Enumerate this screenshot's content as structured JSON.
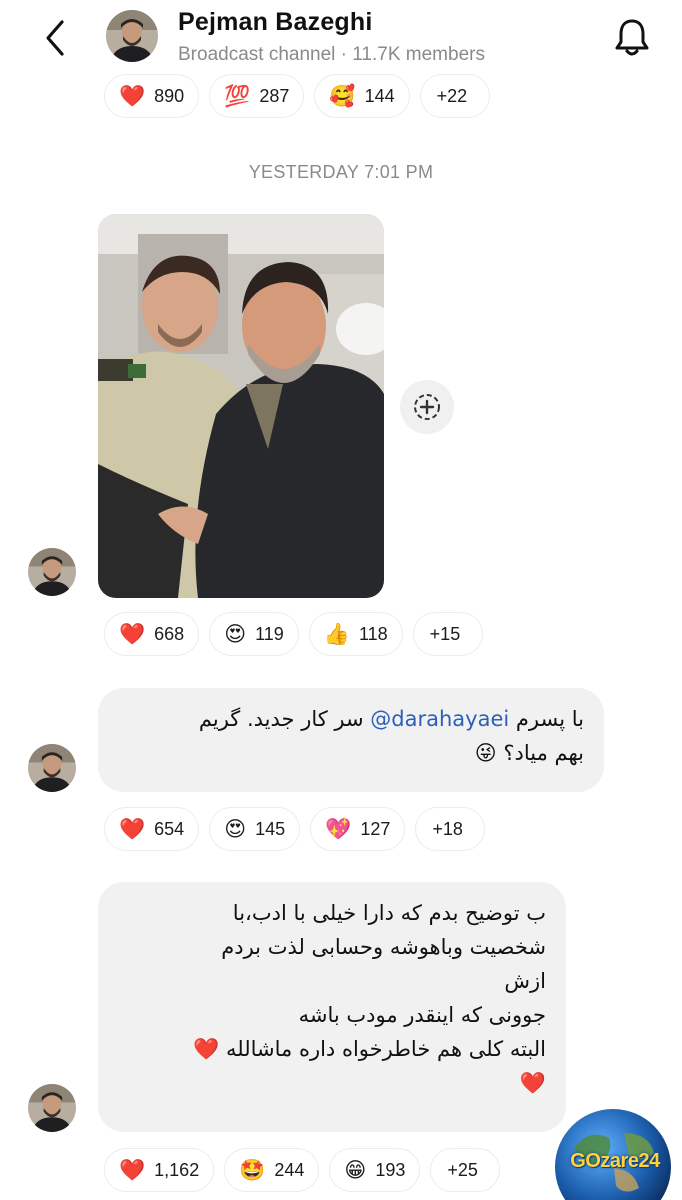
{
  "header": {
    "title": "Pejman Bazeghi",
    "subtitle": "Broadcast channel · 11.7K members",
    "back_icon": "chevron-left-icon",
    "bell_icon": "bell-icon"
  },
  "top_reactions": [
    {
      "emoji": "❤️",
      "count": "890"
    },
    {
      "emoji": "💯",
      "count": "287"
    },
    {
      "emoji": "🥰",
      "count": "144"
    },
    {
      "more": "+22"
    }
  ],
  "day_separator": "YESTERDAY 7:01 PM",
  "photo_reactions": [
    {
      "emoji": "❤️",
      "count": "668"
    },
    {
      "emoji": "😍",
      "count": "119"
    },
    {
      "emoji": "👍",
      "count": "118"
    },
    {
      "more": "+15"
    }
  ],
  "message1": {
    "line1_prefix": "با پسرم",
    "mention": "@darahayaei",
    "line1_suffix": "سر کار جدید. گریم",
    "line2": "بهم میاد؟ 😜"
  },
  "msg1_reactions": [
    {
      "emoji": "❤️",
      "count": "654"
    },
    {
      "emoji": "😍",
      "count": "145"
    },
    {
      "emoji": "💖",
      "count": "127"
    },
    {
      "more": "+18"
    }
  ],
  "message2": {
    "lines": [
      "ب توضیح بدم که دارا خیلی با ادب،با",
      "شخصیت وباهوشه وحسابی لذت بردم",
      "ازش",
      "جوونی که اینقدر مودب باشه",
      "البته کلی هم خاطرخواه داره ماشالله ❤️",
      "❤️"
    ]
  },
  "msg2_reactions": [
    {
      "emoji": "❤️",
      "count": "1,162"
    },
    {
      "emoji": "🤩",
      "count": "244"
    },
    {
      "emoji": "😁",
      "count": "193"
    },
    {
      "more": "+25"
    }
  ],
  "watermark": "GOzare24",
  "colors": {
    "mention": "#2c5fb8",
    "bubble": "#f1f1f1",
    "muted": "#8a8a8a"
  }
}
